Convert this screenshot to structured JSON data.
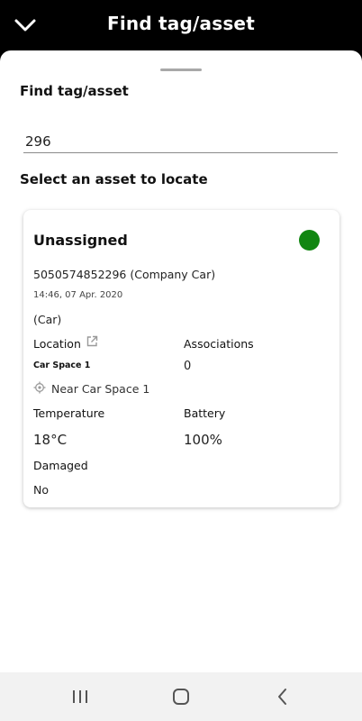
{
  "header": {
    "title": "Find tag/asset",
    "back_icon": "chevron-down-icon"
  },
  "sheet": {
    "heading": "Find tag/asset",
    "search_value": "296",
    "select_heading": "Select an asset to locate"
  },
  "asset_card": {
    "title": "Unassigned",
    "status_color": "#118611",
    "tag_id": "5050574852296 (Company Car)",
    "timestamp": "14:46, 07 Apr. 2020",
    "type": "(Car)",
    "location_label": "Location",
    "location_value": "Car Space 1",
    "near_text": "Near Car Space 1",
    "associations_label": "Associations",
    "associations_value": "0",
    "temperature_label": "Temperature",
    "temperature_value": "18°C",
    "battery_label": "Battery",
    "battery_value": "100%",
    "damaged_label": "Damaged",
    "damaged_value": "No"
  },
  "navbar": {
    "recents_icon": "recent-apps-icon",
    "home_icon": "home-icon",
    "back_icon": "back-icon"
  }
}
